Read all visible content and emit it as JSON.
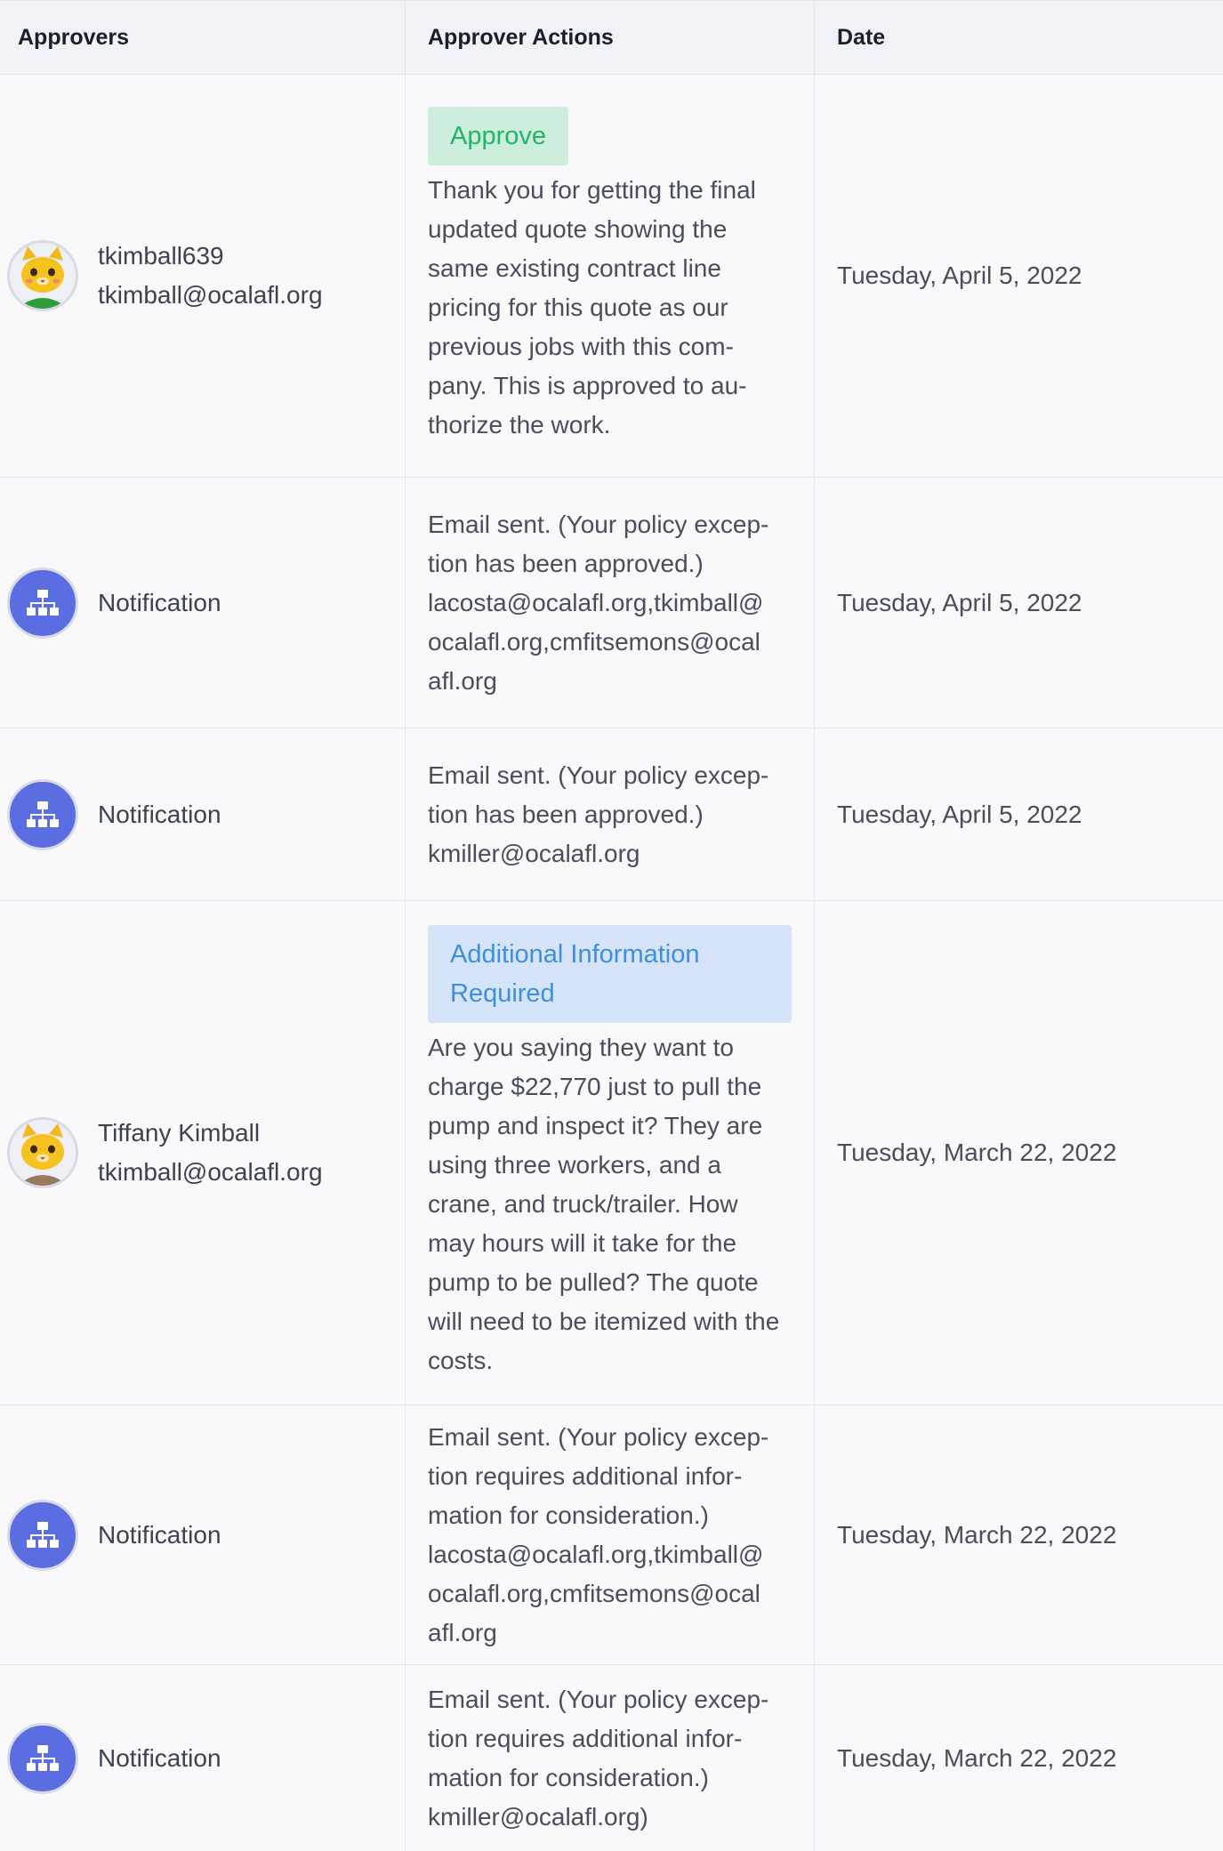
{
  "headers": {
    "approvers": "Approvers",
    "actions": "Approver Actions",
    "date": "Date"
  },
  "rows": [
    {
      "name": "tkimball639",
      "email": "tkimball@ocalafl.org",
      "avatar": "cat-avatar-green",
      "badge": "Approve",
      "text": "Thank you for getting the final updated quote showing the same existing contract line pricing for this quote as our previous jobs with this com-pany. This is approved to au-thorize the work.",
      "date": "Tuesday, April 5, 2022"
    },
    {
      "name": "Notification",
      "avatar": "workflow-icon",
      "text": "Email sent. (Your policy excep-tion has been approved.) lacosta@ocalafl.org,tkimball@ ocalafl.org,cmfitsemons@ocal afl.org",
      "date": "Tuesday, April 5, 2022"
    },
    {
      "name": "Notification",
      "avatar": "workflow-icon",
      "text": "Email sent. (Your policy excep-tion has been approved.) kmiller@ocalafl.org",
      "date": "Tuesday, April 5, 2022"
    },
    {
      "name": "Tiffany Kimball",
      "email": "tkimball@ocalafl.org",
      "avatar": "cat-avatar-brown",
      "badge": "Additional Information Required",
      "text": "Are you saying they want to charge $22,770 just to pull the pump and inspect it? They are using three workers, and a crane, and truck/trailer. How may hours will it take for the pump to be pulled? The quote will need to be itemized with the costs.",
      "date": "Tuesday, March 22, 2022"
    },
    {
      "name": "Notification",
      "avatar": "workflow-icon",
      "text": "Email sent. (Your policy excep-tion requires additional infor-mation for consideration.) lacosta@ocalafl.org,tkimball@ ocalafl.org,cmfitsemons@ocal afl.org",
      "date": "Tuesday, March 22, 2022"
    },
    {
      "name": "Notification",
      "avatar": "workflow-icon",
      "text": "Email sent. (Your policy excep-tion requires additional infor-mation for consideration.) kmiller@ocalafl.org)",
      "date": "Tuesday, March 22, 2022"
    }
  ],
  "colors": {
    "approve_bg": "#cdeedd",
    "approve_text": "#21b46b",
    "info_bg": "#d5e4f8",
    "info_text": "#3e8fe0",
    "bot_avatar": "#5a6ee2"
  }
}
